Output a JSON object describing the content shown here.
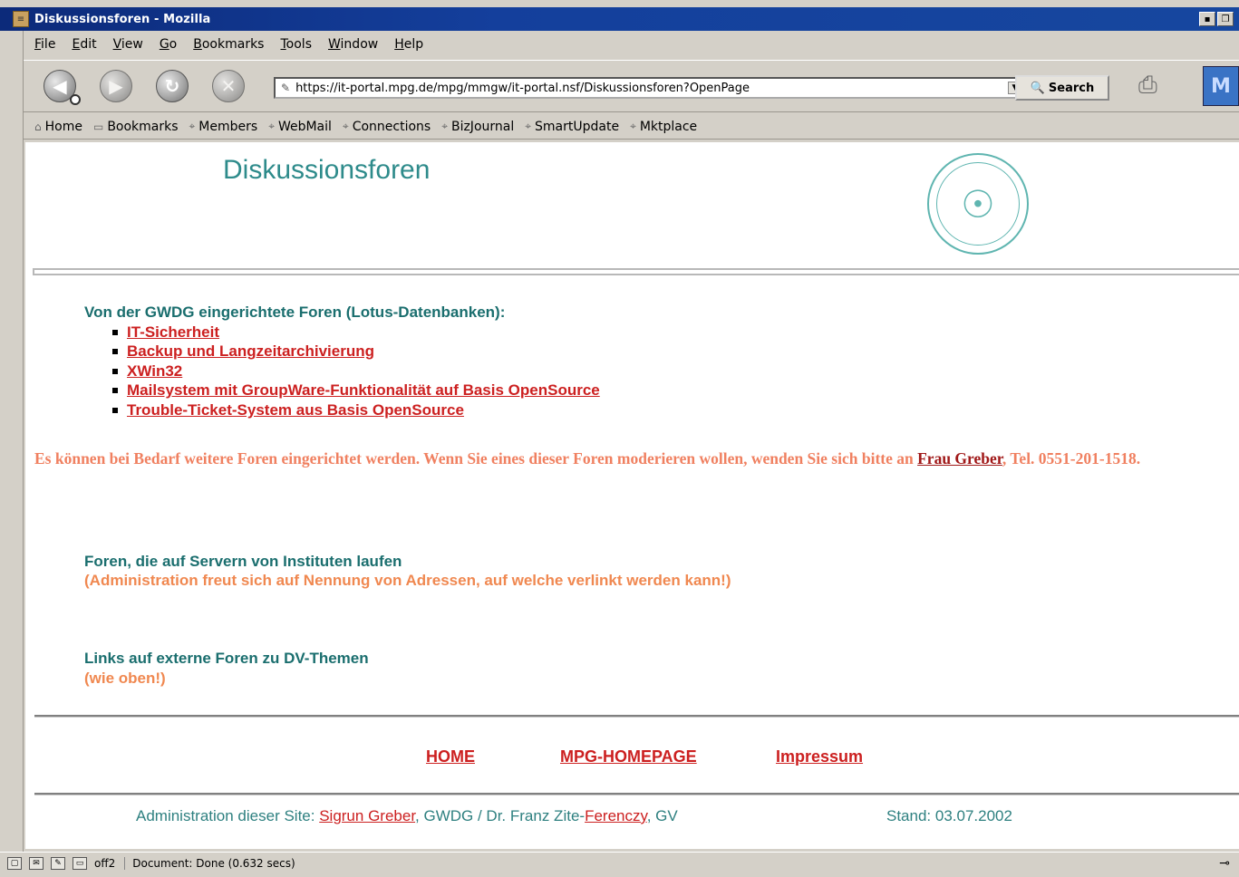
{
  "window": {
    "title": "Diskussionsforen - Mozilla"
  },
  "menu": [
    "File",
    "Edit",
    "View",
    "Go",
    "Bookmarks",
    "Tools",
    "Window",
    "Help"
  ],
  "nav": {
    "url": "https://it-portal.mpg.de/mpg/mmgw/it-portal.nsf/Diskussionsforen?OpenPage",
    "search_label": "Search"
  },
  "bookmarks": [
    "Home",
    "Bookmarks",
    "Members",
    "WebMail",
    "Connections",
    "BizJournal",
    "SmartUpdate",
    "Mktplace"
  ],
  "page": {
    "title": "Diskussionsforen",
    "section1_heading": "Von der GWDG eingerichtete Foren (Lotus-Datenbanken):",
    "forum_links": [
      "IT-Sicherheit",
      "Backup und Langzeitarchivierung",
      "XWin32",
      "Mailsystem mit GroupWare-Funktionalität auf Basis OpenSource",
      "Trouble-Ticket-System aus Basis OpenSource"
    ],
    "note_text": "Es können bei Bedarf weitere Foren eingerichtet werden. Wenn Sie eines dieser Foren moderieren wollen, wenden Sie sich bitte an ",
    "note_link": "Frau Greber",
    "note_tail": ", Tel. 0551-201-1518.",
    "section2_heading": "Foren, die auf Servern von Instituten laufen",
    "section2_note": "(Administration freut sich auf Nennung von Adressen, auf welche verlinkt werden kann!)",
    "section3_heading": "Links auf externe Foren zu DV-Themen",
    "section3_note": "(wie oben!)",
    "footer_links": [
      "HOME",
      "MPG-HOMEPAGE",
      "Impressum"
    ],
    "admin_prefix": "Administration dieser Site: ",
    "admin_link1": "Sigrun Greber",
    "admin_middle": ", GWDG / Dr. Franz Zite-",
    "admin_link2": "Ferenczy",
    "admin_suffix": ", GV",
    "stand": "Stand: 03.07.2002"
  },
  "status": {
    "text": "Document: Done (0.632 secs)",
    "extra": "off2"
  },
  "colors": {
    "teal": "#2e8b8b",
    "link_red": "#cc2020",
    "salmon": "#f08060",
    "titlebar": "#143f9c"
  }
}
